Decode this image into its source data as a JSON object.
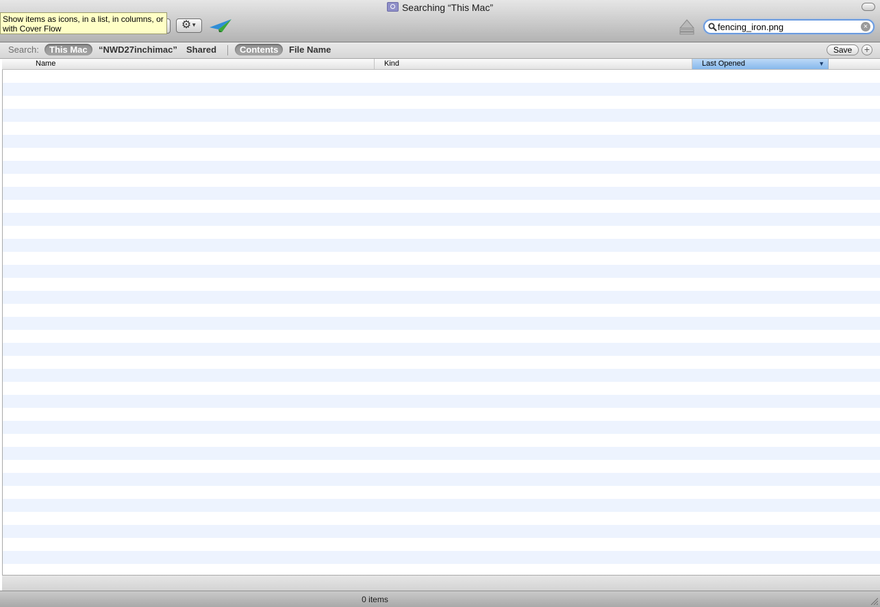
{
  "window": {
    "title": "Searching “This Mac”"
  },
  "toolbar": {
    "tooltip": "Show items as icons, in a list, in columns, or with Cover Flow",
    "search_value": "fencing_iron.png"
  },
  "scope_bar": {
    "label": "Search:",
    "locations": [
      "This Mac",
      "“NWD27inchimac”",
      "Shared"
    ],
    "criteria": [
      "Contents",
      "File Name"
    ],
    "save_label": "Save",
    "add_label": "+"
  },
  "columns": {
    "name": "Name",
    "kind": "Kind",
    "last_opened": "Last Opened"
  },
  "status": {
    "count": "0 items"
  },
  "colors": {
    "row_alt": "#edf3fe",
    "sort_column": "#86b8ec",
    "search_focus": "#6a9be0"
  }
}
